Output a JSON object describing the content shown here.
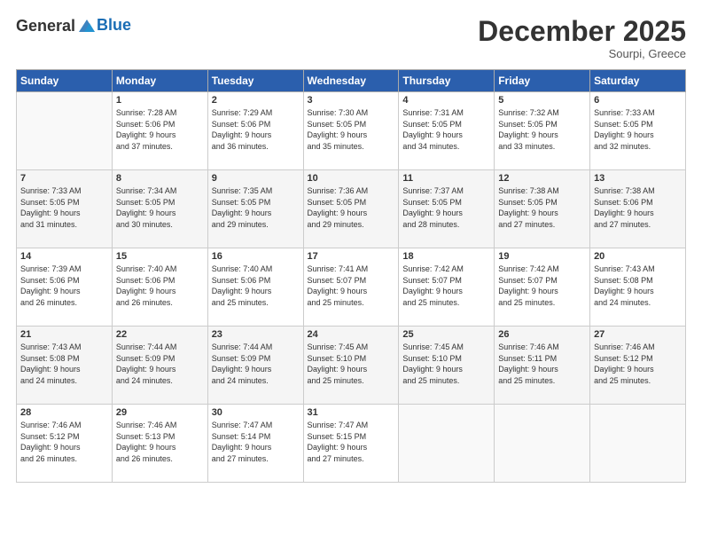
{
  "header": {
    "logo_general": "General",
    "logo_blue": "Blue",
    "title": "December 2025",
    "location": "Sourpi, Greece"
  },
  "weekdays": [
    "Sunday",
    "Monday",
    "Tuesday",
    "Wednesday",
    "Thursday",
    "Friday",
    "Saturday"
  ],
  "rows": [
    [
      {
        "day": "",
        "info": ""
      },
      {
        "day": "1",
        "info": "Sunrise: 7:28 AM\nSunset: 5:06 PM\nDaylight: 9 hours\nand 37 minutes."
      },
      {
        "day": "2",
        "info": "Sunrise: 7:29 AM\nSunset: 5:06 PM\nDaylight: 9 hours\nand 36 minutes."
      },
      {
        "day": "3",
        "info": "Sunrise: 7:30 AM\nSunset: 5:05 PM\nDaylight: 9 hours\nand 35 minutes."
      },
      {
        "day": "4",
        "info": "Sunrise: 7:31 AM\nSunset: 5:05 PM\nDaylight: 9 hours\nand 34 minutes."
      },
      {
        "day": "5",
        "info": "Sunrise: 7:32 AM\nSunset: 5:05 PM\nDaylight: 9 hours\nand 33 minutes."
      },
      {
        "day": "6",
        "info": "Sunrise: 7:33 AM\nSunset: 5:05 PM\nDaylight: 9 hours\nand 32 minutes."
      }
    ],
    [
      {
        "day": "7",
        "info": "Sunrise: 7:33 AM\nSunset: 5:05 PM\nDaylight: 9 hours\nand 31 minutes."
      },
      {
        "day": "8",
        "info": "Sunrise: 7:34 AM\nSunset: 5:05 PM\nDaylight: 9 hours\nand 30 minutes."
      },
      {
        "day": "9",
        "info": "Sunrise: 7:35 AM\nSunset: 5:05 PM\nDaylight: 9 hours\nand 29 minutes."
      },
      {
        "day": "10",
        "info": "Sunrise: 7:36 AM\nSunset: 5:05 PM\nDaylight: 9 hours\nand 29 minutes."
      },
      {
        "day": "11",
        "info": "Sunrise: 7:37 AM\nSunset: 5:05 PM\nDaylight: 9 hours\nand 28 minutes."
      },
      {
        "day": "12",
        "info": "Sunrise: 7:38 AM\nSunset: 5:05 PM\nDaylight: 9 hours\nand 27 minutes."
      },
      {
        "day": "13",
        "info": "Sunrise: 7:38 AM\nSunset: 5:06 PM\nDaylight: 9 hours\nand 27 minutes."
      }
    ],
    [
      {
        "day": "14",
        "info": "Sunrise: 7:39 AM\nSunset: 5:06 PM\nDaylight: 9 hours\nand 26 minutes."
      },
      {
        "day": "15",
        "info": "Sunrise: 7:40 AM\nSunset: 5:06 PM\nDaylight: 9 hours\nand 26 minutes."
      },
      {
        "day": "16",
        "info": "Sunrise: 7:40 AM\nSunset: 5:06 PM\nDaylight: 9 hours\nand 25 minutes."
      },
      {
        "day": "17",
        "info": "Sunrise: 7:41 AM\nSunset: 5:07 PM\nDaylight: 9 hours\nand 25 minutes."
      },
      {
        "day": "18",
        "info": "Sunrise: 7:42 AM\nSunset: 5:07 PM\nDaylight: 9 hours\nand 25 minutes."
      },
      {
        "day": "19",
        "info": "Sunrise: 7:42 AM\nSunset: 5:07 PM\nDaylight: 9 hours\nand 25 minutes."
      },
      {
        "day": "20",
        "info": "Sunrise: 7:43 AM\nSunset: 5:08 PM\nDaylight: 9 hours\nand 24 minutes."
      }
    ],
    [
      {
        "day": "21",
        "info": "Sunrise: 7:43 AM\nSunset: 5:08 PM\nDaylight: 9 hours\nand 24 minutes."
      },
      {
        "day": "22",
        "info": "Sunrise: 7:44 AM\nSunset: 5:09 PM\nDaylight: 9 hours\nand 24 minutes."
      },
      {
        "day": "23",
        "info": "Sunrise: 7:44 AM\nSunset: 5:09 PM\nDaylight: 9 hours\nand 24 minutes."
      },
      {
        "day": "24",
        "info": "Sunrise: 7:45 AM\nSunset: 5:10 PM\nDaylight: 9 hours\nand 25 minutes."
      },
      {
        "day": "25",
        "info": "Sunrise: 7:45 AM\nSunset: 5:10 PM\nDaylight: 9 hours\nand 25 minutes."
      },
      {
        "day": "26",
        "info": "Sunrise: 7:46 AM\nSunset: 5:11 PM\nDaylight: 9 hours\nand 25 minutes."
      },
      {
        "day": "27",
        "info": "Sunrise: 7:46 AM\nSunset: 5:12 PM\nDaylight: 9 hours\nand 25 minutes."
      }
    ],
    [
      {
        "day": "28",
        "info": "Sunrise: 7:46 AM\nSunset: 5:12 PM\nDaylight: 9 hours\nand 26 minutes."
      },
      {
        "day": "29",
        "info": "Sunrise: 7:46 AM\nSunset: 5:13 PM\nDaylight: 9 hours\nand 26 minutes."
      },
      {
        "day": "30",
        "info": "Sunrise: 7:47 AM\nSunset: 5:14 PM\nDaylight: 9 hours\nand 27 minutes."
      },
      {
        "day": "31",
        "info": "Sunrise: 7:47 AM\nSunset: 5:15 PM\nDaylight: 9 hours\nand 27 minutes."
      },
      {
        "day": "",
        "info": ""
      },
      {
        "day": "",
        "info": ""
      },
      {
        "day": "",
        "info": ""
      }
    ]
  ]
}
